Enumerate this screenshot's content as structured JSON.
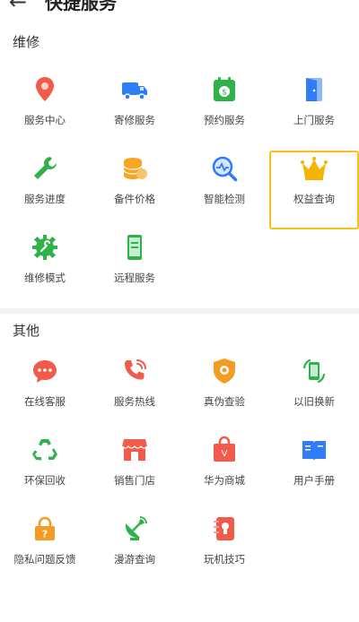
{
  "header": {
    "title": "快捷服务",
    "back_icon": "back-arrow-icon"
  },
  "sections": [
    {
      "title": "维修",
      "items": [
        {
          "label": "服务中心",
          "icon": "location-pin-icon",
          "color": "#f25b4a"
        },
        {
          "label": "寄修服务",
          "icon": "truck-icon",
          "color": "#2f7cf6"
        },
        {
          "label": "预约服务",
          "icon": "calendar-money-icon",
          "color": "#2fb24a"
        },
        {
          "label": "上门服务",
          "icon": "door-icon",
          "color": "#2f7cf6"
        },
        {
          "label": "服务进度",
          "icon": "wrench-icon",
          "color": "#2fb24a"
        },
        {
          "label": "备件价格",
          "icon": "coins-icon",
          "color": "#f5a623"
        },
        {
          "label": "智能检测",
          "icon": "magnifier-pulse-icon",
          "color": "#2f7cf6"
        },
        {
          "label": "权益查询",
          "icon": "crown-icon",
          "color": "#f5b400",
          "highlight": true
        },
        {
          "label": "维修模式",
          "icon": "gear-wrench-icon",
          "color": "#2fb24a"
        },
        {
          "label": "远程服务",
          "icon": "remote-phone-icon",
          "color": "#2fb24a"
        }
      ]
    },
    {
      "title": "其他",
      "items": [
        {
          "label": "在线客服",
          "icon": "chat-bubble-icon",
          "color": "#f25b4a"
        },
        {
          "label": "服务热线",
          "icon": "phone-icon",
          "color": "#f25b4a"
        },
        {
          "label": "真伪查验",
          "icon": "shield-check-icon",
          "color": "#f59a23"
        },
        {
          "label": "以旧换新",
          "icon": "phone-recycle-icon",
          "color": "#2fb24a"
        },
        {
          "label": "环保回收",
          "icon": "recycle-icon",
          "color": "#2fb24a"
        },
        {
          "label": "销售门店",
          "icon": "store-icon",
          "color": "#f25b4a"
        },
        {
          "label": "华为商城",
          "icon": "shopping-bag-icon",
          "color": "#f25b4a"
        },
        {
          "label": "用户手册",
          "icon": "book-icon",
          "color": "#2f7cf6"
        },
        {
          "label": "隐私问题反馈",
          "icon": "lock-question-icon",
          "color": "#f59a23"
        },
        {
          "label": "漫游查询",
          "icon": "satellite-icon",
          "color": "#2fb24a"
        },
        {
          "label": "玩机技巧",
          "icon": "tips-phone-icon",
          "color": "#f25b4a"
        }
      ]
    }
  ]
}
